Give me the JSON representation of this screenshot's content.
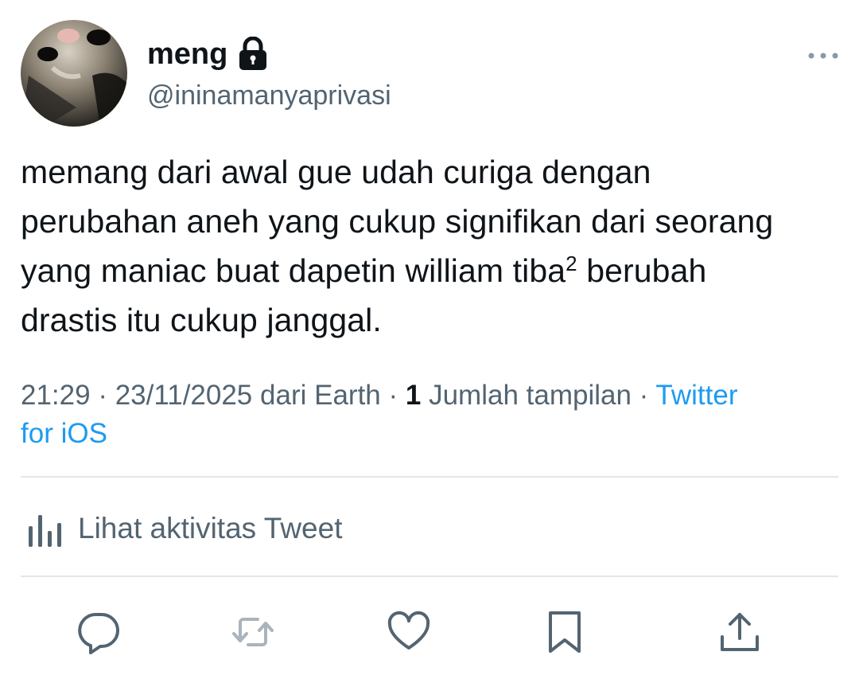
{
  "user": {
    "display_name": "meng",
    "handle": "@ininamanyaprivasi",
    "protected_icon": "lock-icon",
    "avatar_icon": "avatar"
  },
  "tweet": {
    "lines": [
      "memang dari awal gue udah curiga dengan",
      "perubahan aneh yang cukup signifikan dari seorang",
      "yang maniac buat dapetin william tiba",
      "drastis itu cukup janggal."
    ],
    "superscript": "2",
    "line3_tail": " berubah"
  },
  "meta": {
    "time": "21:29",
    "date": "23/11/2025",
    "location": "dari Earth",
    "separator": " · ",
    "view_count": "1",
    "view_label": "Jumlah tampilan",
    "source_part1": "Twitter",
    "source_part2": "for iOS"
  },
  "activity": {
    "label": "Lihat aktivitas Tweet",
    "icon": "bar-chart-icon"
  },
  "actions": {
    "reply_icon": "reply-icon",
    "retweet_icon": "retweet-icon",
    "like_icon": "heart-icon",
    "bookmark_icon": "bookmark-icon",
    "share_icon": "share-icon"
  },
  "more_icon": "more-icon",
  "colors": {
    "text": "#0f1419",
    "secondary": "#536471",
    "link": "#1d9bf0",
    "divider": "#e1e6ea"
  }
}
